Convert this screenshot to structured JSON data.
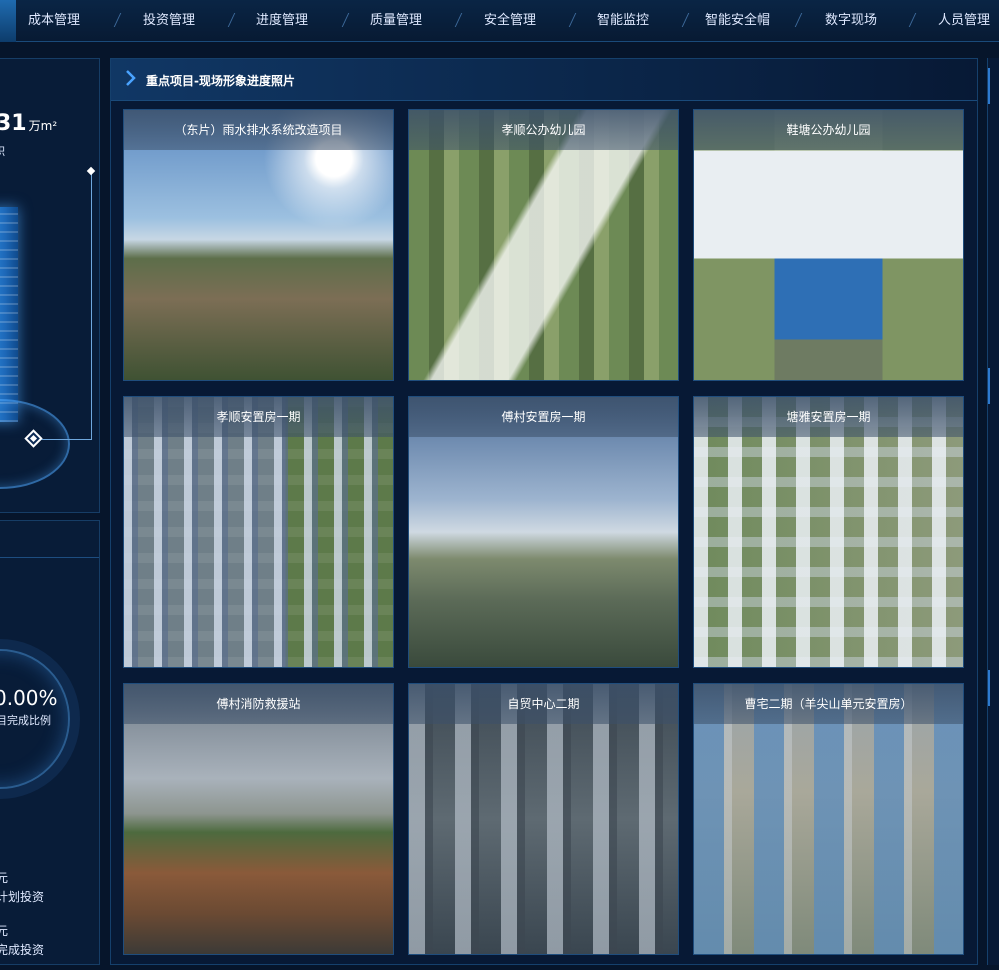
{
  "nav": {
    "items": [
      "成本管理",
      "投资管理",
      "进度管理",
      "质量管理",
      "安全管理",
      "智能监控",
      "智能安全帽",
      "数字现场",
      "人员管理"
    ]
  },
  "left": {
    "area_value": "31",
    "area_unit": "万m²",
    "area_label": "积",
    "percent": "0.00%",
    "percent_label": "目完成比例",
    "plan_unit": "元",
    "plan_label": "计划投资",
    "done_unit": "元",
    "done_label": "完成投资"
  },
  "panel": {
    "title": "重点项目-现场形象进度照片",
    "photos": [
      {
        "caption": "（东片）雨水排水系统改造项目"
      },
      {
        "caption": "孝顺公办幼儿园"
      },
      {
        "caption": "鞋塘公办幼儿园"
      },
      {
        "caption": "孝顺安置房一期"
      },
      {
        "caption": "傅村安置房一期"
      },
      {
        "caption": "塘雅安置房一期"
      },
      {
        "caption": "傅村消防救援站"
      },
      {
        "caption": "自贸中心二期"
      },
      {
        "caption": "曹宅二期（羊尖山单元安置房）"
      }
    ]
  },
  "colors": {
    "background": "#06152b",
    "panel": "#081a36",
    "accent": "#2e7bd0",
    "border": "#15406c"
  }
}
